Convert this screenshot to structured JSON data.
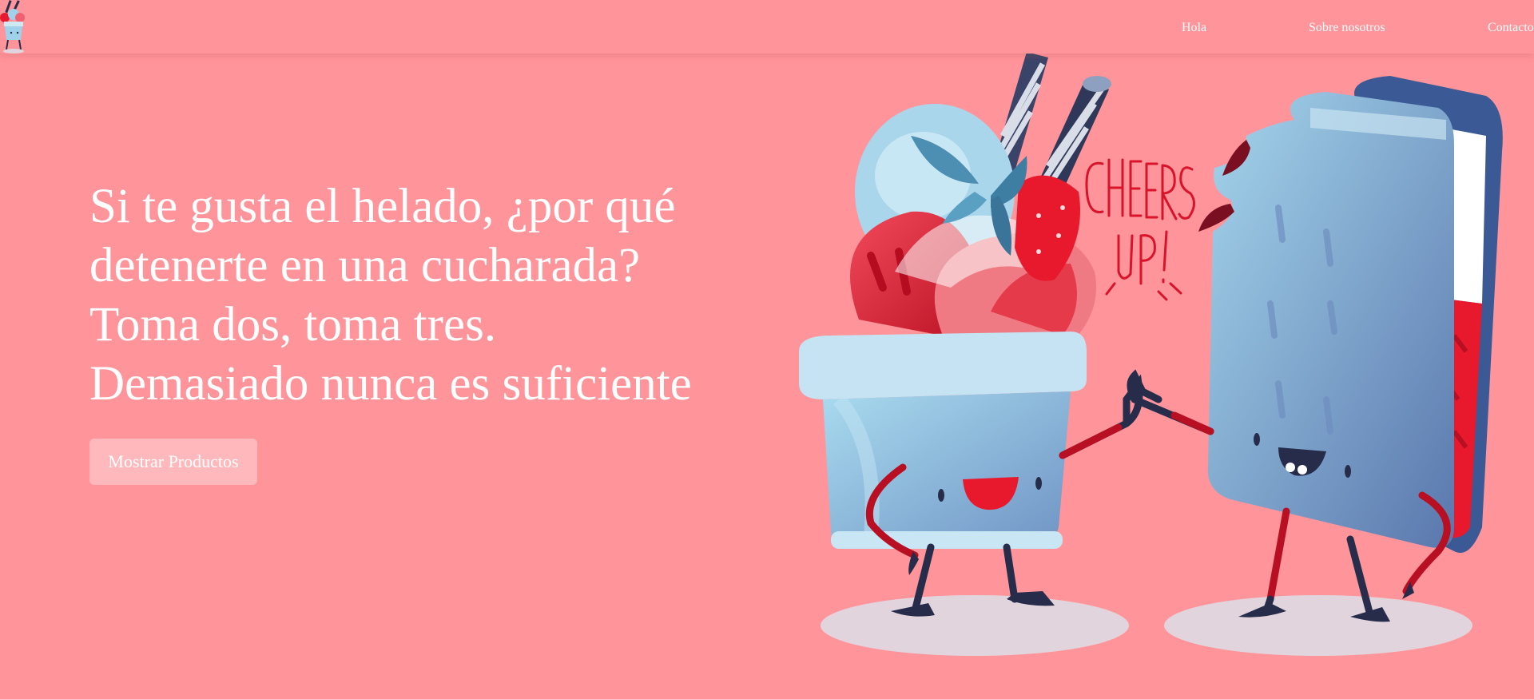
{
  "header": {
    "logo_icon": "ice-cream-cup-mascot-logo",
    "nav": [
      {
        "label": "Hola"
      },
      {
        "label": "Sobre nosotros"
      },
      {
        "label": "Contacto"
      }
    ]
  },
  "hero": {
    "lines": [
      "Si te gusta el helado, ¿por qué",
      "detenerte en una cucharada?",
      "Toma dos, toma tres.",
      "Demasiado nunca es suficiente"
    ],
    "button_label": "Mostrar Productos"
  },
  "illustration": {
    "lettering": [
      "CHEERS",
      "UP!"
    ]
  },
  "colors": {
    "background": "#ff949a",
    "button": "#ffb9bd",
    "text": "#ffffff",
    "ice_blue": "#9fd2ea",
    "strawberry_red": "#e8192c",
    "dark_navy": "#262c4a",
    "shadow": "#e2d4dc"
  }
}
